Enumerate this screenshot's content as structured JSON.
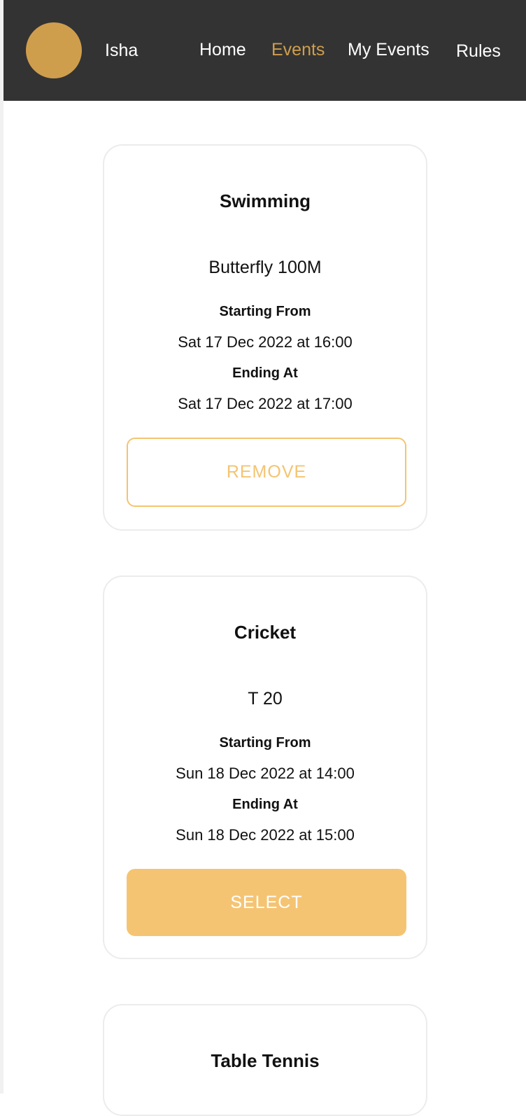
{
  "header": {
    "user_name": "Isha",
    "nav": {
      "home": "Home",
      "events": "Events",
      "my_events": "My Events",
      "rules": "Rules"
    },
    "colors": {
      "background": "#333333",
      "accent": "#cf9e4d",
      "avatar": "#cf9e4d"
    }
  },
  "events": [
    {
      "title": "Swimming",
      "subtitle": "Butterfly 100M",
      "start_label": "Starting From",
      "start": "Sat 17 Dec 2022 at 16:00",
      "end_label": "Ending At",
      "end": "Sat 17 Dec 2022 at 17:00",
      "action": "REMOVE"
    },
    {
      "title": "Cricket",
      "subtitle": "T 20",
      "start_label": "Starting From",
      "start": "Sun 18 Dec 2022 at 14:00",
      "end_label": "Ending At",
      "end": "Sun 18 Dec 2022 at 15:00",
      "action": "SELECT"
    },
    {
      "title": "Table Tennis"
    }
  ],
  "button_colors": {
    "primary": "#f5c473",
    "outline": "#f4c471"
  }
}
